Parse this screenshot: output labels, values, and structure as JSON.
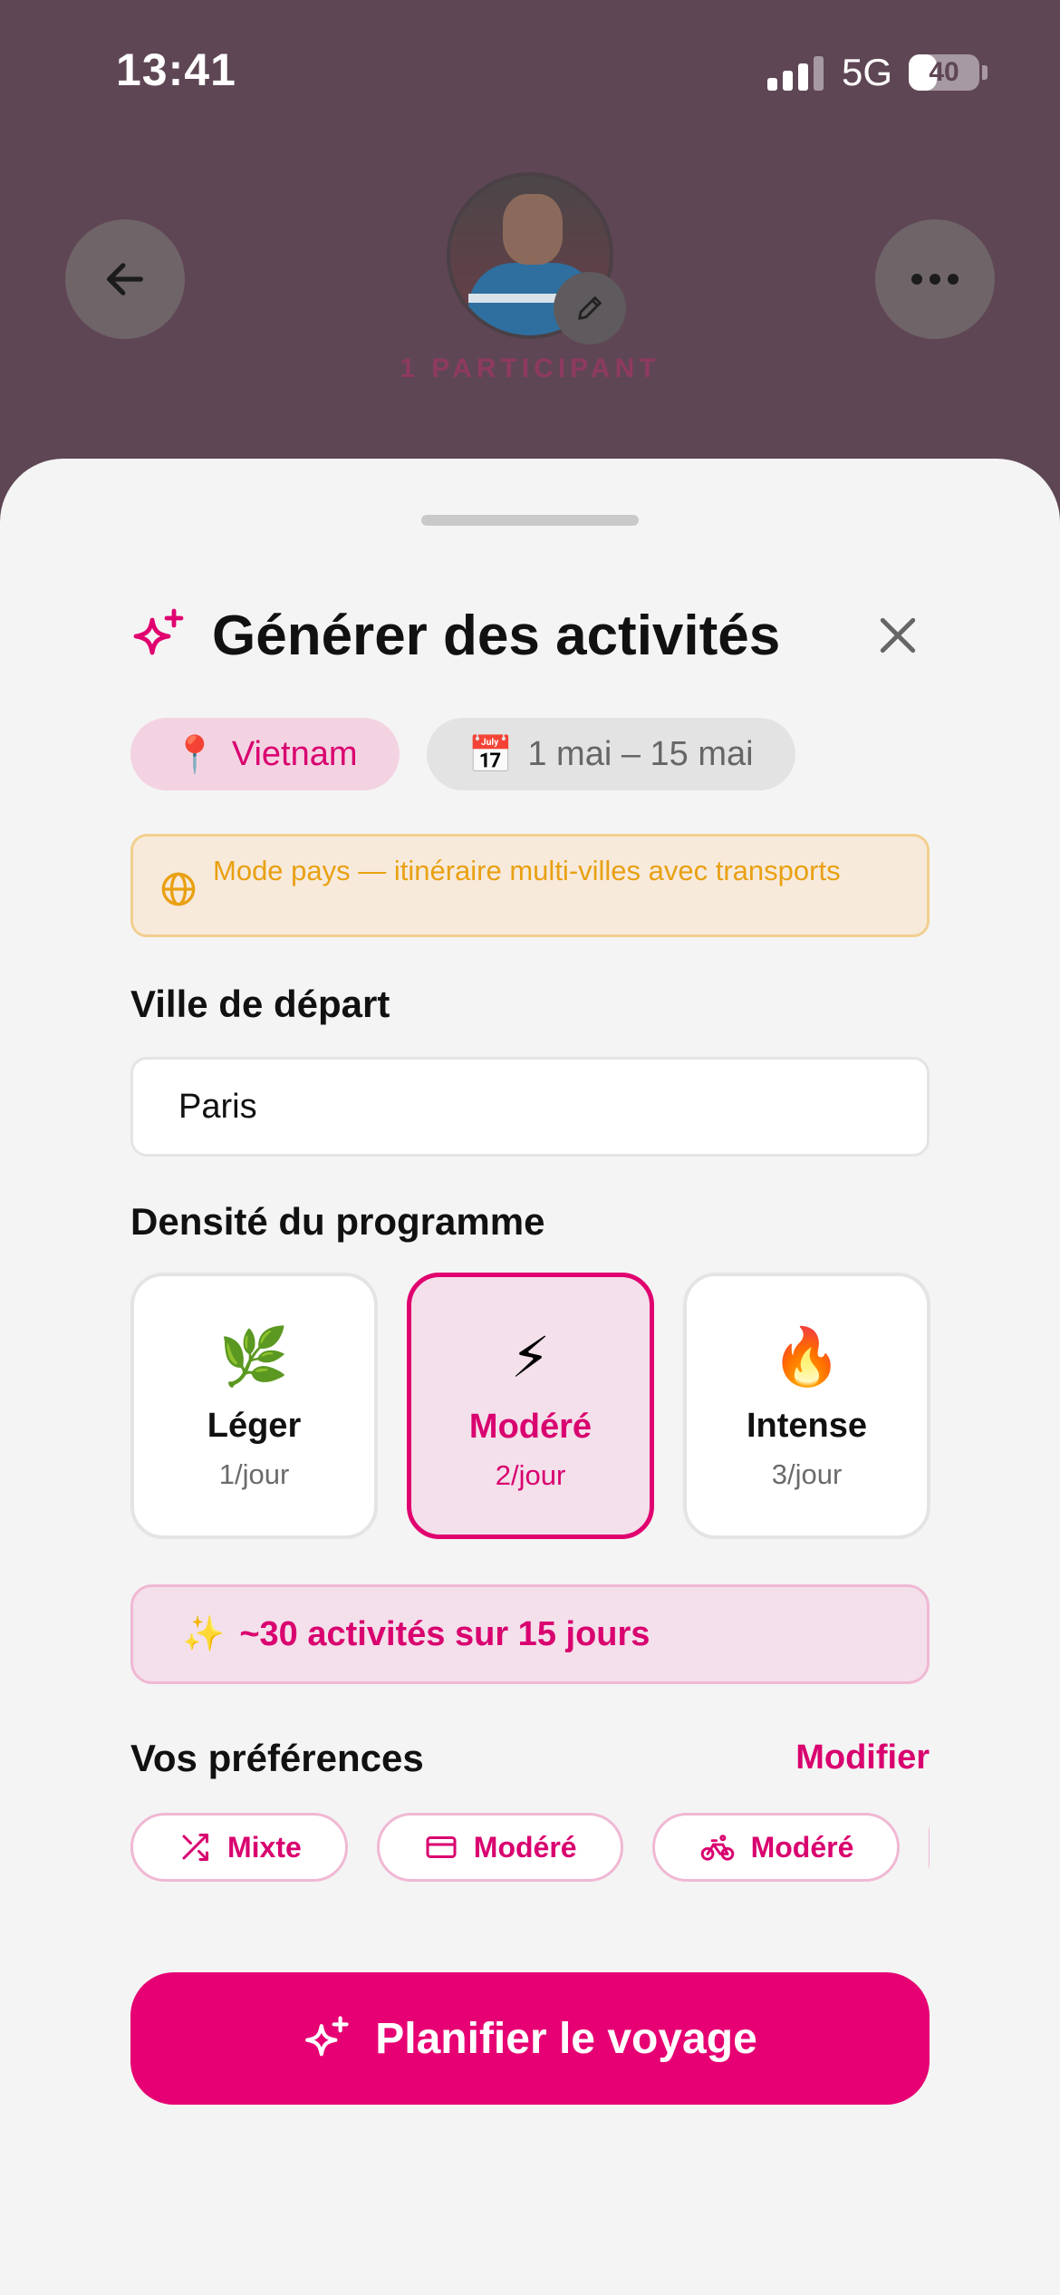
{
  "status_bar": {
    "time": "13:41",
    "network": "5G",
    "battery": "40",
    "battery_level": 0.4
  },
  "background": {
    "participants": "1 PARTICIPANT",
    "back_icon": "arrow-left-icon",
    "more_icon": "ellipsis-icon",
    "edit_icon": "pencil-icon"
  },
  "sheet": {
    "title": "Générer des activités",
    "title_icon": "sparkles-icon",
    "close_icon": "close-icon",
    "location_chip": {
      "emoji": "📍",
      "label": "Vietnam"
    },
    "dates_chip": {
      "emoji": "📅",
      "label": "1 mai – 15 mai"
    },
    "notice": {
      "icon": "globe-icon",
      "text": "Mode pays — itinéraire multi-villes avec transports"
    },
    "departure": {
      "label": "Ville de départ",
      "value": "Paris"
    },
    "density": {
      "label": "Densité du programme",
      "options": [
        {
          "emoji": "🌿",
          "name": "Léger",
          "rate": "1/jour",
          "selected": false
        },
        {
          "emoji": "⚡",
          "name": "Modéré",
          "rate": "2/jour",
          "selected": true
        },
        {
          "emoji": "🔥",
          "name": "Intense",
          "rate": "3/jour",
          "selected": false
        }
      ]
    },
    "summary": {
      "emoji": "✨",
      "text": "~30 activités sur 15 jours"
    },
    "preferences": {
      "label": "Vos préférences",
      "modify": "Modifier",
      "chips": [
        {
          "icon": "shuffle-icon",
          "label": "Mixte"
        },
        {
          "icon": "credit-card-icon",
          "label": "Modéré"
        },
        {
          "icon": "bike-icon",
          "label": "Modéré"
        }
      ]
    },
    "cta": {
      "icon": "sparkles-icon",
      "label": "Planifier le voyage"
    }
  },
  "colors": {
    "accent": "#e60073",
    "accent_text": "#d9006f",
    "overlay": "#5f4654",
    "sheet_bg": "#f4f4f4",
    "notice_text": "#e9a012"
  }
}
